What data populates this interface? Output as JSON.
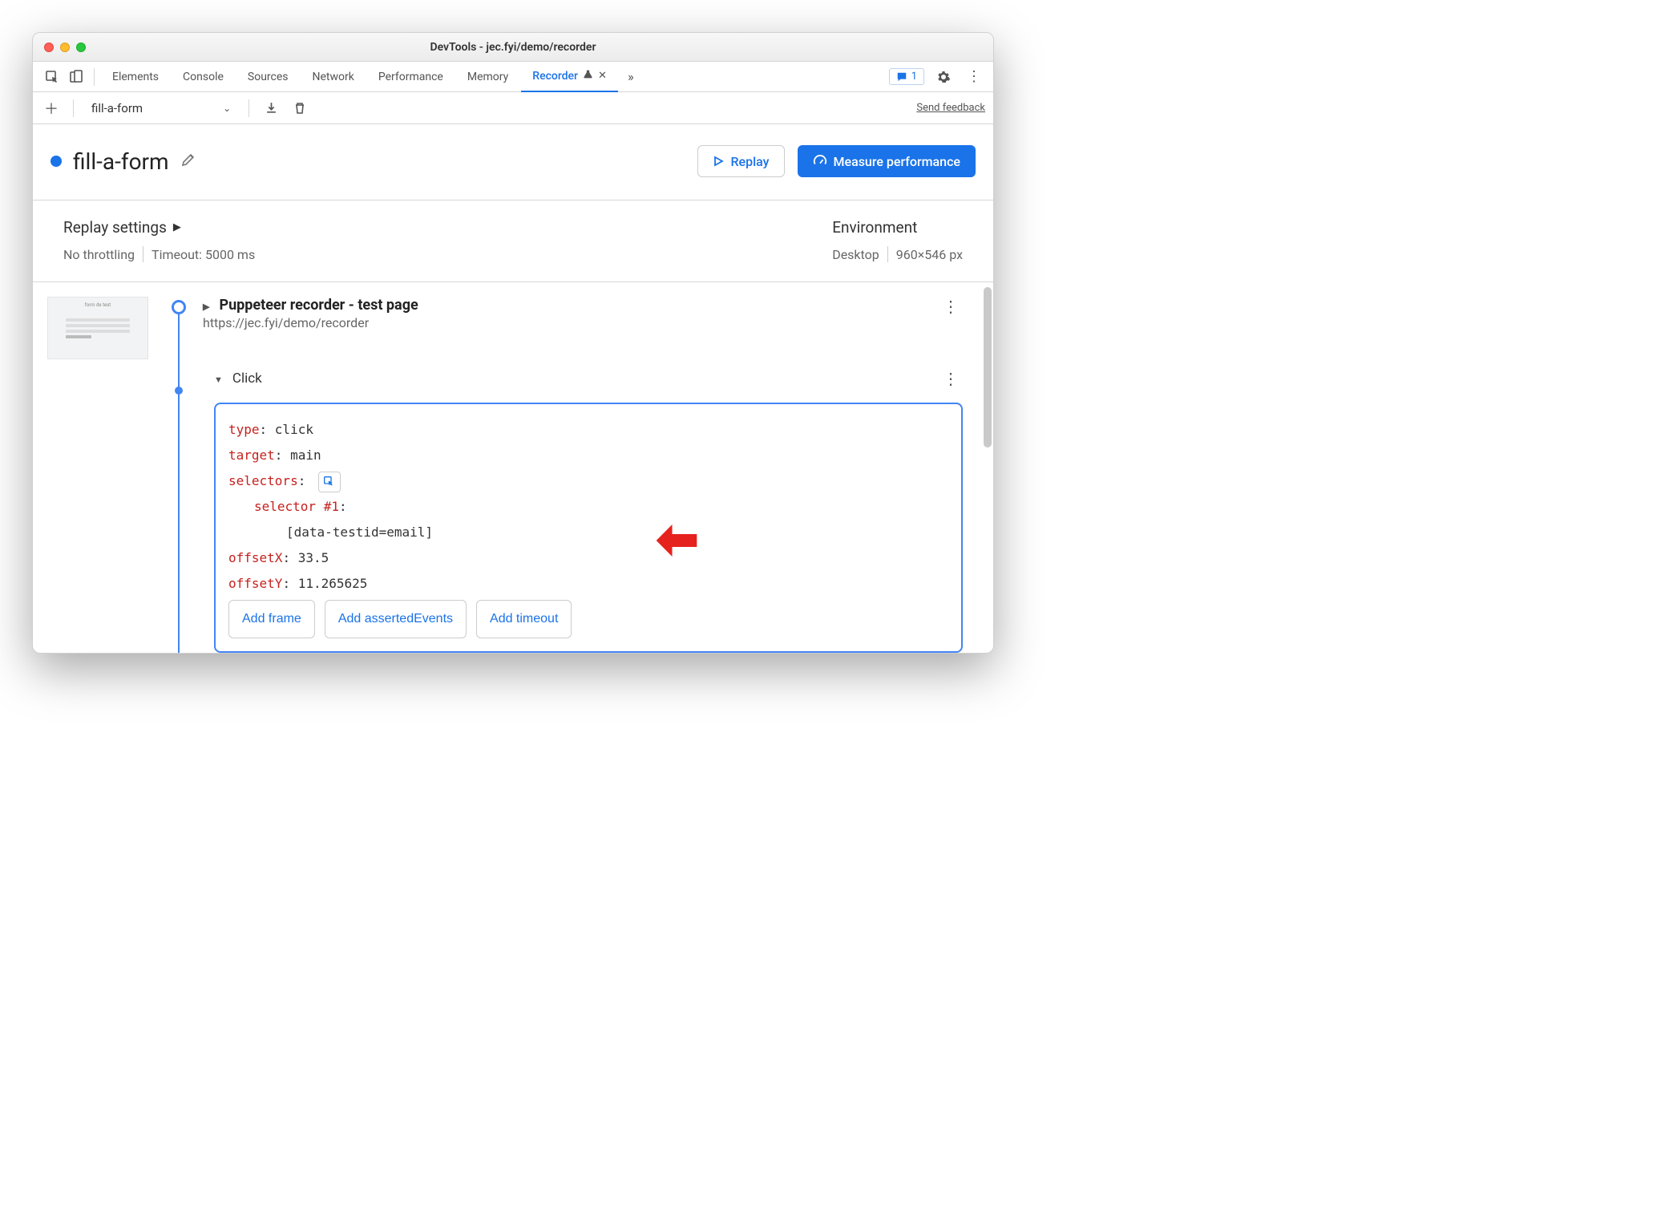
{
  "window": {
    "title": "DevTools - jec.fyi/demo/recorder"
  },
  "tabs": {
    "items": [
      "Elements",
      "Console",
      "Sources",
      "Network",
      "Performance",
      "Memory"
    ],
    "active": "Recorder",
    "issues_count": "1"
  },
  "toolbar": {
    "recording_name": "fill-a-form",
    "send_feedback": "Send feedback"
  },
  "header": {
    "title": "fill-a-form",
    "replay_label": "Replay",
    "measure_label": "Measure performance"
  },
  "settings": {
    "replay_label": "Replay settings",
    "throttling": "No throttling",
    "timeout": "Timeout: 5000 ms",
    "env_label": "Environment",
    "device": "Desktop",
    "viewport": "960×546 px"
  },
  "steps": {
    "s1_title": "Puppeteer recorder - test page",
    "s1_url": "https://jec.fyi/demo/recorder",
    "s2_title": "Click",
    "detail": {
      "type_k": "type",
      "type_v": "click",
      "target_k": "target",
      "target_v": "main",
      "selectors_k": "selectors",
      "selector1_k": "selector #1",
      "selector1_v": "[data-testid=email]",
      "offx_k": "offsetX",
      "offx_v": "33.5",
      "offy_k": "offsetY",
      "offy_v": "11.265625",
      "add_frame": "Add frame",
      "add_asserted": "Add assertedEvents",
      "add_timeout": "Add timeout"
    }
  }
}
